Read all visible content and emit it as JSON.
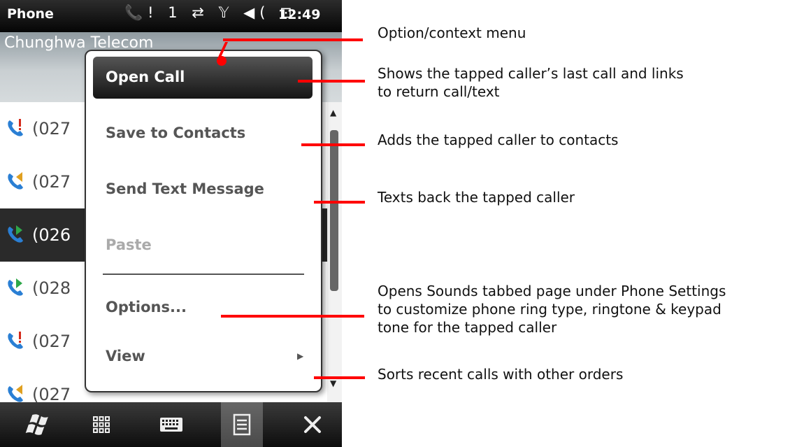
{
  "status_bar": {
    "app_title": "Phone",
    "indicators": "📞! 1 ⇄ 𝕐 ◀( ⊡",
    "time": "12:49"
  },
  "carrier": "Chunghwa Telecom",
  "call_list": [
    {
      "number": "(027",
      "type": "missed",
      "icon": "phone-missed-icon"
    },
    {
      "number": "(027",
      "type": "outgoing",
      "icon": "phone-outgoing-icon"
    },
    {
      "number": "(026",
      "type": "incoming",
      "icon": "phone-incoming-icon",
      "selected": true
    },
    {
      "number": "(028",
      "type": "incoming",
      "icon": "phone-incoming-icon"
    },
    {
      "number": "(027",
      "type": "missed",
      "icon": "phone-missed-icon"
    },
    {
      "number": "(027",
      "type": "outgoing",
      "icon": "phone-outgoing-icon"
    }
  ],
  "context_menu": {
    "items": [
      {
        "label": "Open Call"
      },
      {
        "label": "Save to Contacts"
      },
      {
        "label": "Send Text Message"
      },
      {
        "label": "Paste",
        "disabled": true
      },
      {
        "label": "Options..."
      },
      {
        "label": "View",
        "submenu": true
      }
    ]
  },
  "toolbar": {
    "icons": [
      "windows-start-icon",
      "apps-grid-icon",
      "keyboard-icon",
      "menu-icon",
      "close-icon"
    ]
  },
  "annotations": {
    "context_menu": "Option/context menu",
    "open_call": [
      "Shows the tapped caller’s last call and links",
      "to return call/text"
    ],
    "save_contacts": "Adds the tapped caller to contacts",
    "send_text": "Texts back the tapped caller",
    "options": [
      "Opens Sounds tabbed page under Phone Settings",
      "to customize phone ring type, ringtone & keypad",
      "tone for the tapped caller"
    ],
    "view": "Sorts recent calls with other orders"
  },
  "colors": {
    "annotation": "#ff0000",
    "missed": "#d42a1a",
    "outgoing": "#e0a020",
    "incoming": "#2ea84a",
    "handset": "#2a7fd4"
  }
}
